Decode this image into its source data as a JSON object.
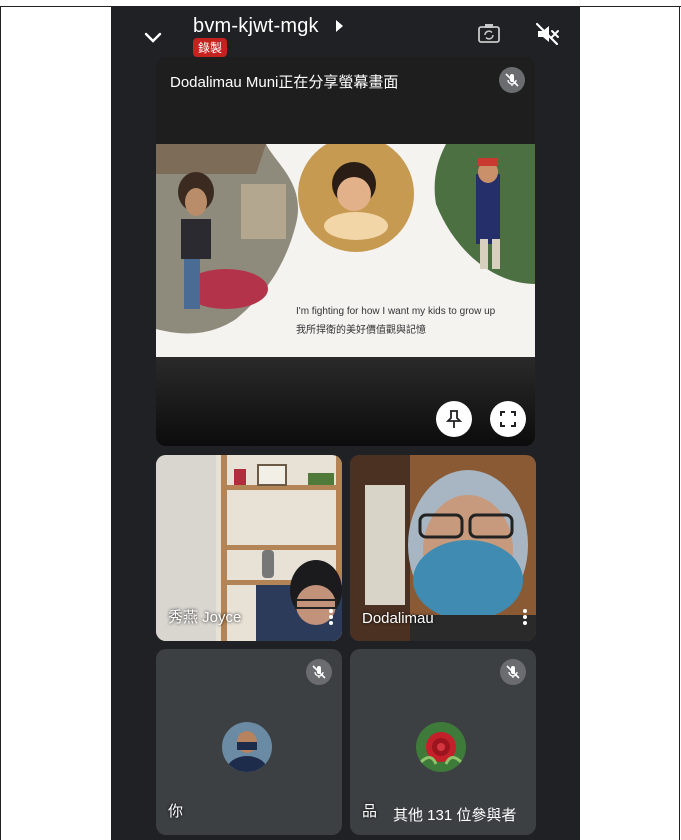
{
  "header": {
    "meeting_code": "bvm-kjwt-mgk",
    "recording_badge": "錄製",
    "back_icon": "chevron-down-icon",
    "switch_camera_icon": "camera-switch-icon",
    "speaker_icon": "speaker-off-icon"
  },
  "presenter": {
    "label": "Dodalimau Muni正在分享螢幕畫面",
    "slide_caption_en": "I'm fighting for how I want my kids to grow up",
    "slide_caption_zh": "我所捍衛的美好價值觀與記憶",
    "pin_icon": "pin-icon",
    "fullscreen_icon": "fullscreen-icon"
  },
  "participants": [
    {
      "name": "秀燕 Joyce"
    },
    {
      "name": "Dodalimau"
    },
    {
      "name": "你"
    },
    {
      "name": "品"
    }
  ],
  "others_label": "其他 131 位參與者",
  "colors": {
    "background": "#202124",
    "tile": "#3c4043",
    "record_red": "#c5221f"
  }
}
